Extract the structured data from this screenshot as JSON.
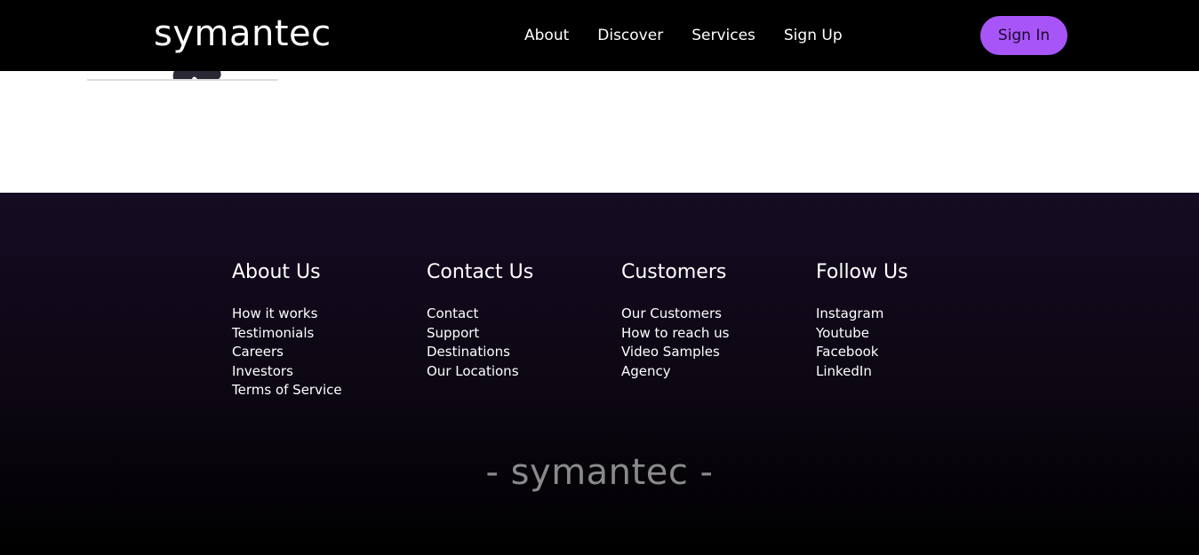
{
  "header": {
    "logo": "symantec",
    "nav": [
      "About",
      "Discover",
      "Services",
      "Sign Up"
    ],
    "signin_label": "Sign In"
  },
  "footer": {
    "columns": [
      {
        "heading": "About Us",
        "links": [
          "How it works",
          "Testimonials",
          "Careers",
          "Investors",
          "Terms of Service"
        ]
      },
      {
        "heading": "Contact Us",
        "links": [
          "Contact",
          "Support",
          "Destinations",
          "Our Locations"
        ]
      },
      {
        "heading": "Customers",
        "links": [
          "Our Customers",
          "How to reach us",
          "Video Samples",
          "Agency"
        ]
      },
      {
        "heading": "Follow Us",
        "links": [
          "Instagram",
          "Youtube",
          "Facebook",
          "LinkedIn"
        ]
      }
    ],
    "brand": "- symantec -"
  },
  "colors": {
    "navbar_bg": "#000000",
    "accent": "#a855f7",
    "footer_top": "#150b22",
    "footer_bottom": "#000000",
    "brand_text": "#8a8a8a"
  }
}
